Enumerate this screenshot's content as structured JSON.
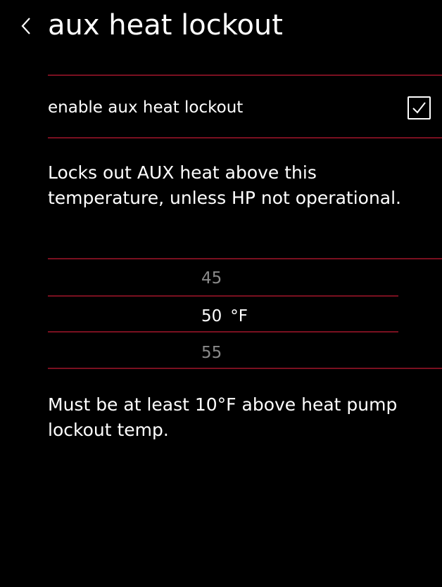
{
  "header": {
    "back_icon": "chevron-left-icon",
    "title": "aux heat lockout"
  },
  "toggle_row": {
    "label": "enable aux heat lockout",
    "checked": true,
    "icon": "checkmark-icon"
  },
  "description": "Locks out AUX heat above this temperature, unless HP not operational.",
  "picker": {
    "prev": "45",
    "current": "50",
    "unit": "°F",
    "next": "55"
  },
  "note": "Must be at least 10°F above heat pump lockout temp.",
  "colors": {
    "background": "#000000",
    "text": "#ffffff",
    "divider": "#7a1020",
    "dim_text": "#8a8a8a"
  }
}
